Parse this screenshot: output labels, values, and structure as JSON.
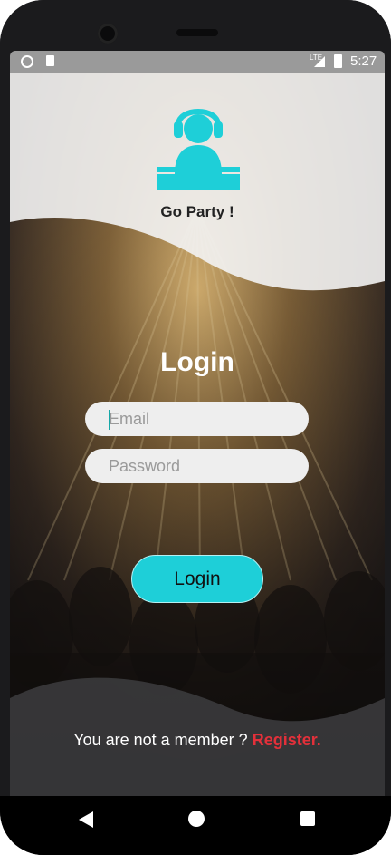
{
  "status_bar": {
    "time": "5:27",
    "network": "LTE"
  },
  "brand": {
    "name": "Go Party !",
    "icon": "dj-headphones-icon",
    "color": "#1ecfd8"
  },
  "login": {
    "title": "Login",
    "email_placeholder": "Email",
    "password_placeholder": "Password",
    "button_label": "Login"
  },
  "footer": {
    "prompt": "You are not a member ?",
    "register_label": "Register.",
    "register_color": "#e3303a"
  },
  "nav": {
    "back": "back-icon",
    "home": "home-icon",
    "recents": "recents-icon"
  }
}
